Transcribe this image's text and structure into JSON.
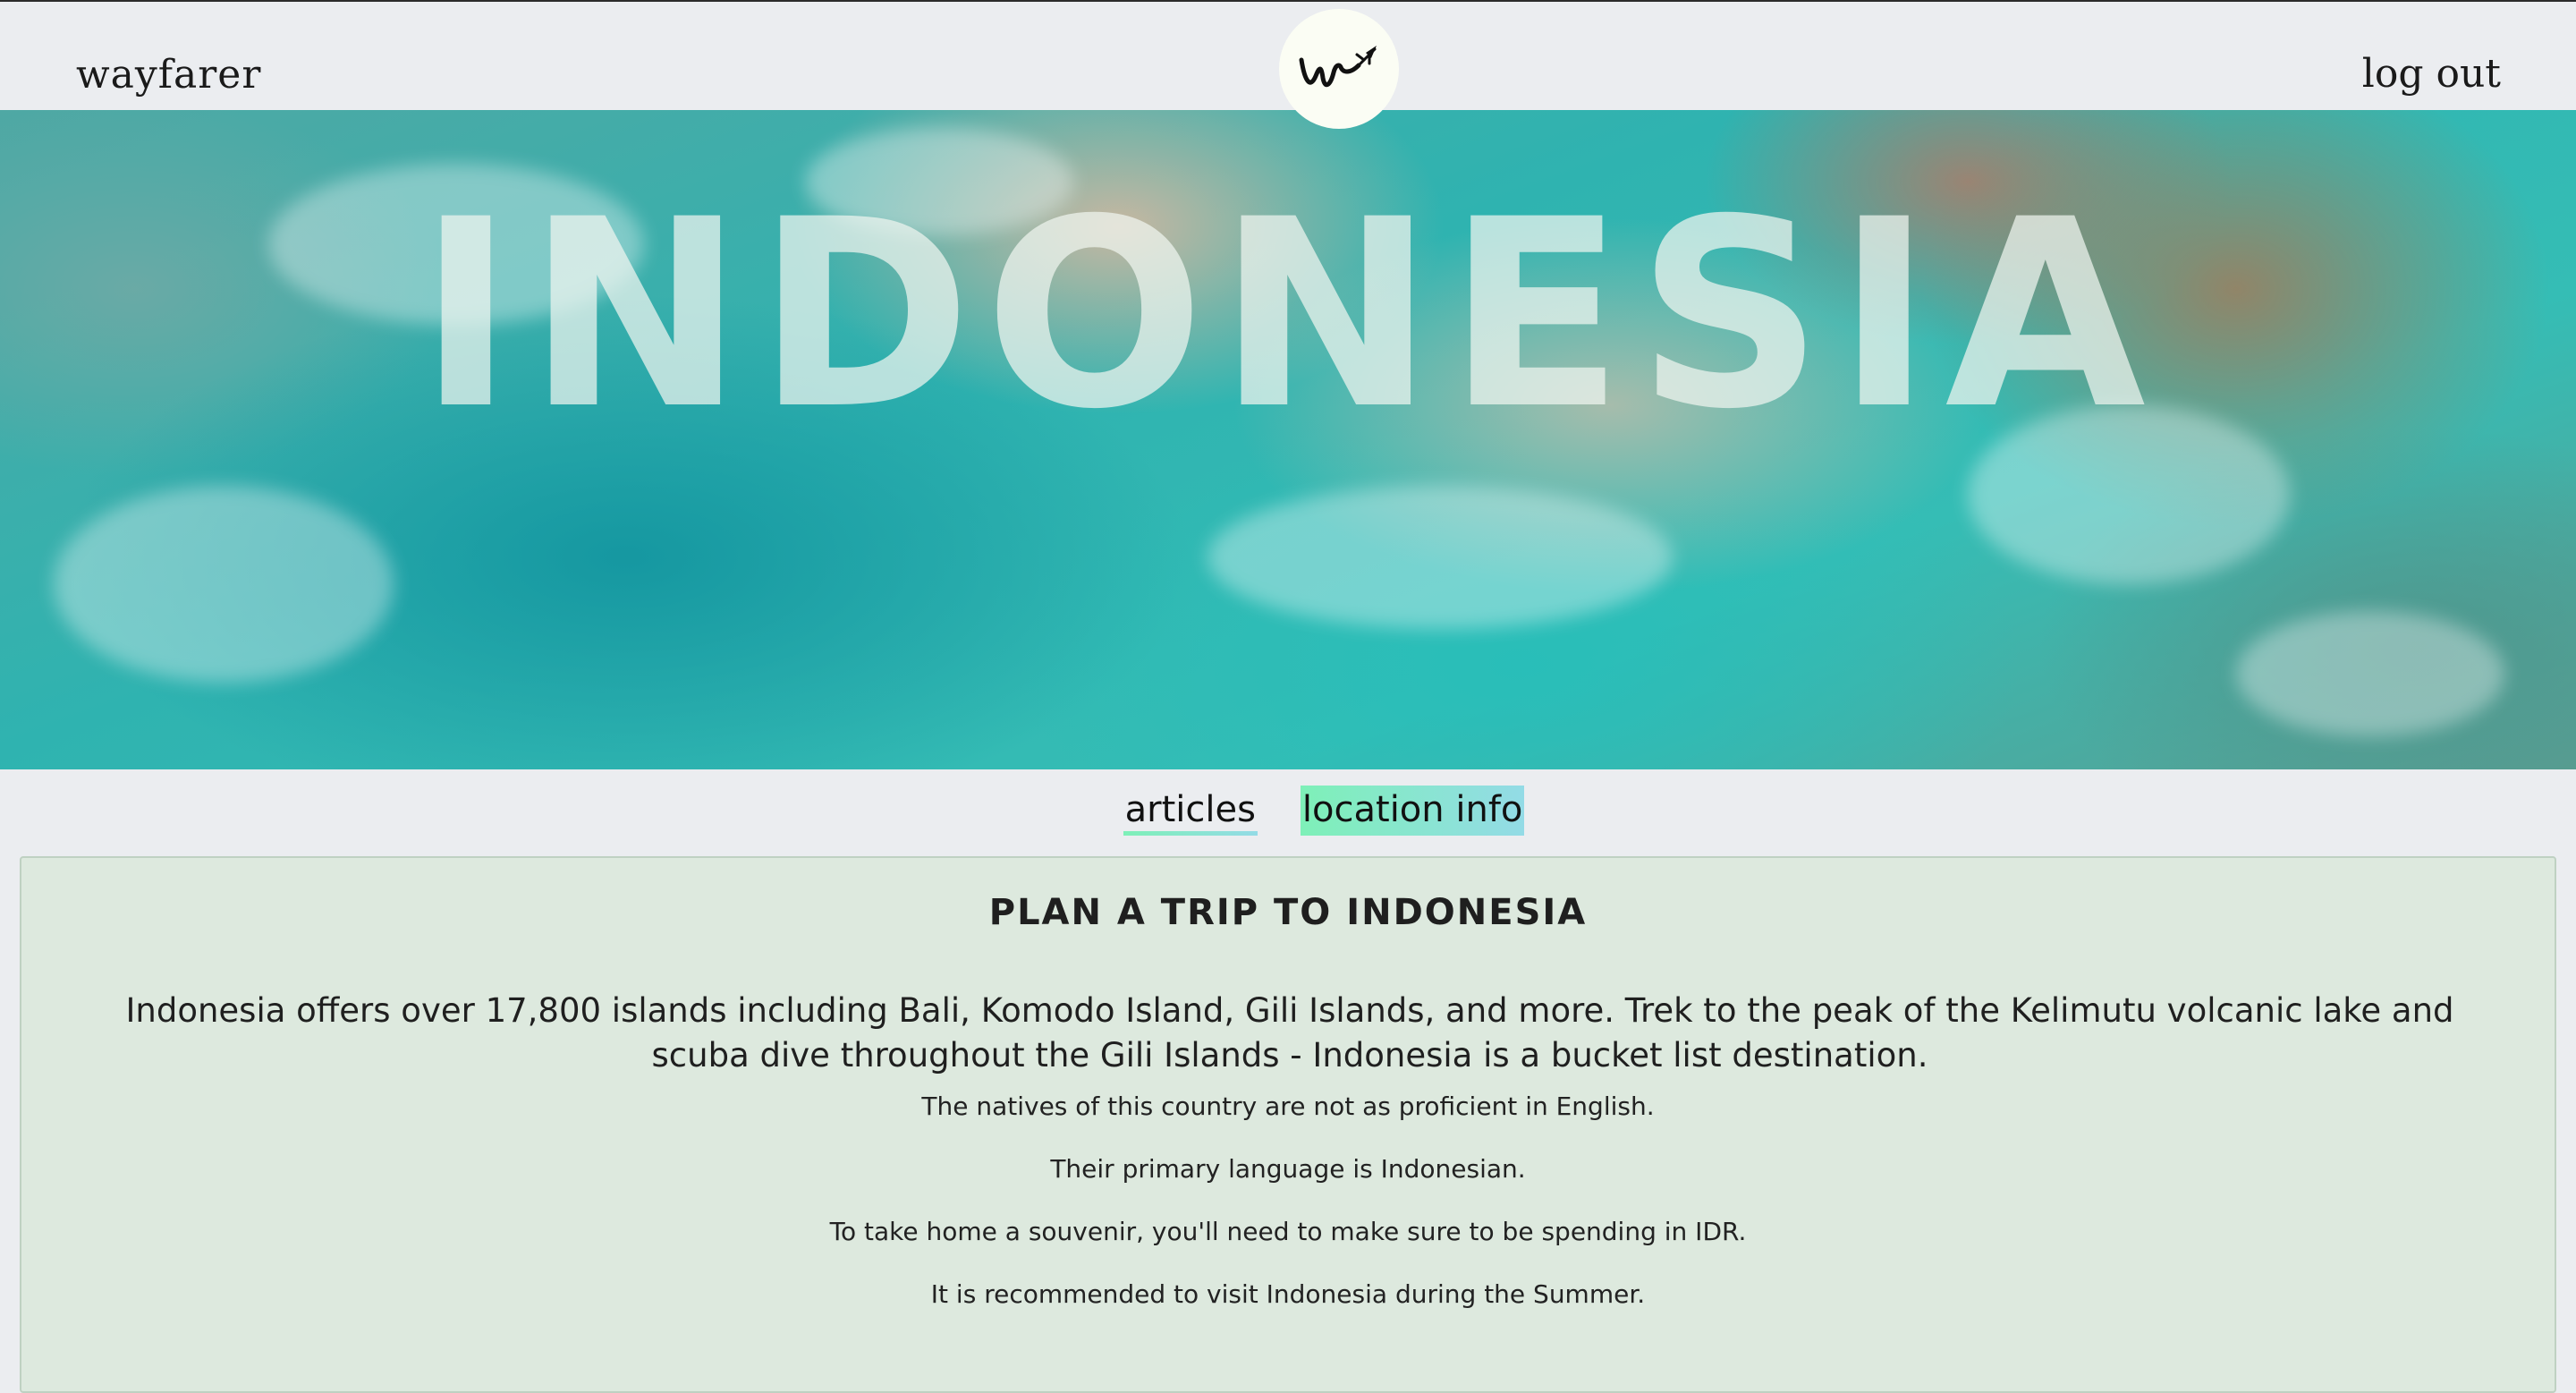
{
  "navbar": {
    "brand": "wayfarer",
    "logout": "log out",
    "logo_icon": "airplane-signature-logo"
  },
  "hero": {
    "title": "INDONESIA"
  },
  "tabs": [
    {
      "label": "articles",
      "active": false
    },
    {
      "label": "location info",
      "active": true
    }
  ],
  "panel": {
    "title": "PLAN A TRIP TO INDONESIA",
    "intro": "Indonesia offers over 17,800 islands including Bali, Komodo Island, Gili Islands, and more. Trek to the peak of the Kelimutu volcanic lake and scuba dive throughout the Gili Islands - Indonesia is a bucket list destination.",
    "facts": [
      "The natives of this country are not as proficient in English.",
      "Their primary language is Indonesian.",
      "To take home a souvenir, you'll need to make sure to be spending in IDR.",
      "It is recommended to visit Indonesia during the Summer."
    ]
  },
  "colors": {
    "page_bg": "#ebedf0",
    "panel_bg": "#dde9de",
    "tab_gradient_start": "#7ef0b8",
    "tab_gradient_end": "#93dbe6"
  }
}
